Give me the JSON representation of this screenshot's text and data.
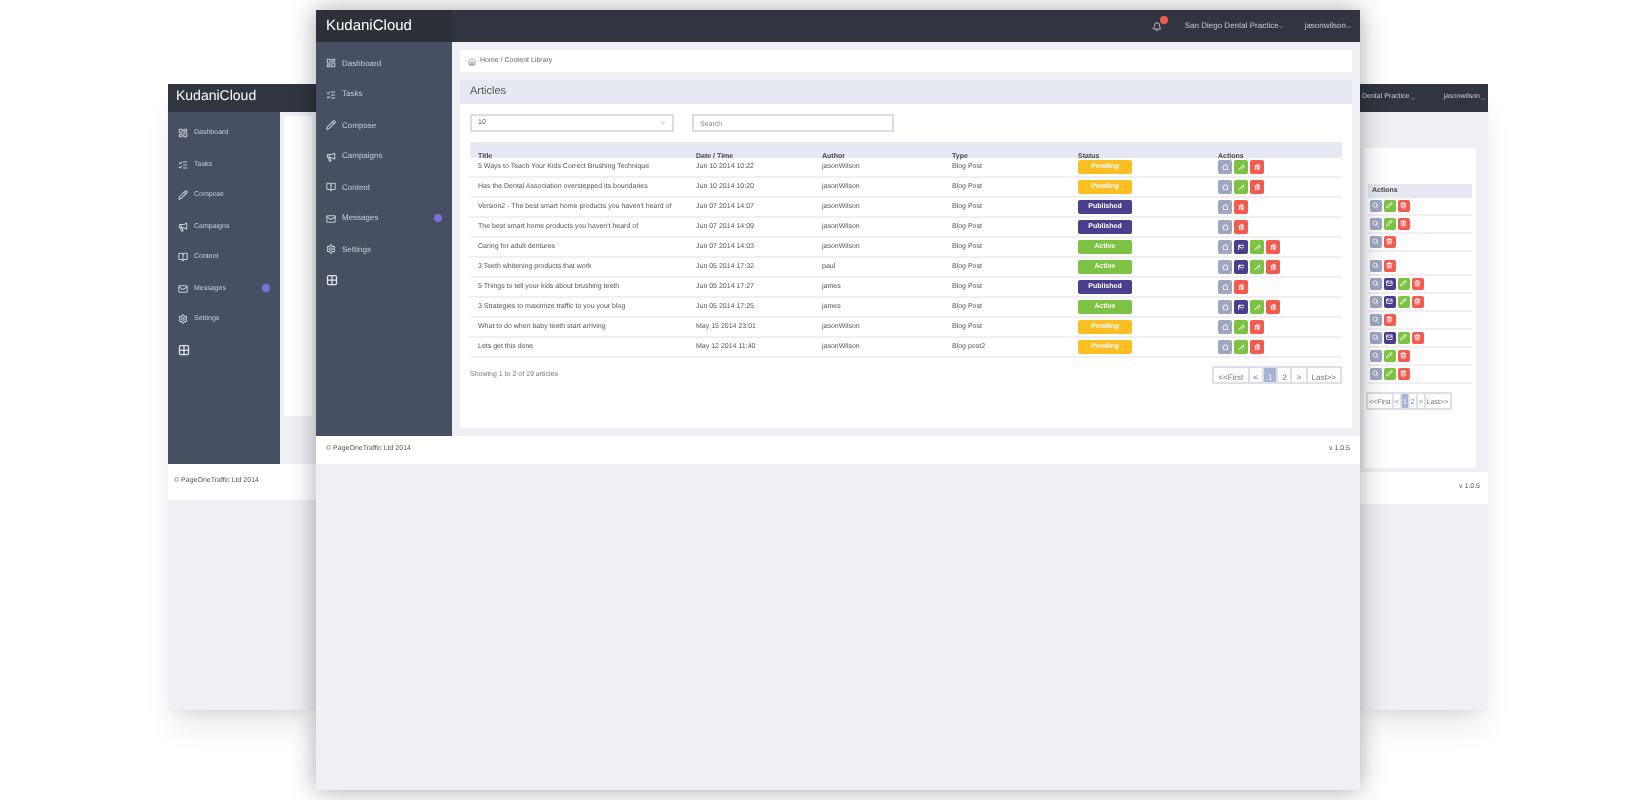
{
  "back_left_window": {
    "logo": "**Kudani**Cloud",
    "sidebar": [
      {
        "label": "Dashboard"
      },
      {
        "label": "Tasks"
      },
      {
        "label": "Compose"
      },
      {
        "label": "Campaigns"
      },
      {
        "label": "Content"
      },
      {
        "label": "Messages",
        "badge": true
      },
      {
        "label": "Settings"
      },
      {
        "kind": "icon_only"
      }
    ],
    "footer": "© PageOneTraffic Ltd 2014"
  },
  "back_right_window": {
    "practice": "Dental Practice",
    "user": "jasonwilson",
    "actions_heading": "Actions",
    "action_rows": [
      [
        {
          "kind": "view"
        },
        {
          "kind": "edit"
        },
        {
          "kind": "delete"
        }
      ],
      [
        {
          "kind": "view"
        },
        {
          "kind": "edit"
        },
        {
          "kind": "delete"
        }
      ],
      [
        {
          "kind": "view"
        },
        {
          "kind": "delete"
        }
      ],
      [
        {
          "kind": "view"
        },
        {
          "kind": "delete"
        }
      ],
      [
        {
          "kind": "view"
        },
        {
          "kind": "message"
        },
        {
          "kind": "edit"
        },
        {
          "kind": "delete"
        }
      ],
      [
        {
          "kind": "view"
        },
        {
          "kind": "message"
        },
        {
          "kind": "edit"
        },
        {
          "kind": "delete"
        }
      ],
      [
        {
          "kind": "view"
        },
        {
          "kind": "delete"
        }
      ],
      [
        {
          "kind": "view"
        },
        {
          "kind": "message"
        },
        {
          "kind": "edit"
        },
        {
          "kind": "delete"
        }
      ],
      [
        {
          "kind": "view"
        },
        {
          "kind": "edit"
        },
        {
          "kind": "delete"
        }
      ],
      [
        {
          "kind": "view"
        },
        {
          "kind": "edit"
        },
        {
          "kind": "delete"
        }
      ]
    ],
    "pagination": [
      {
        "label": "<<First",
        "selected": false
      },
      {
        "label": "<",
        "selected": false
      },
      {
        "label": "1",
        "selected": true
      },
      {
        "label": "2",
        "selected": false
      },
      {
        "label": ">",
        "selected": false
      },
      {
        "label": "Last>>",
        "selected": false
      }
    ],
    "version": "v 1.0.5"
  },
  "window": {
    "logo": "**Kudani**Cloud",
    "notification_badge": true,
    "practice": "San Diego Dental Practice",
    "user": "jasonwilson",
    "sidebar": [
      {
        "label": "Dashboard"
      },
      {
        "label": "Tasks"
      },
      {
        "label": "Compose"
      },
      {
        "label": "Campaigns"
      },
      {
        "label": "Content"
      },
      {
        "label": "Messages",
        "badge": true
      },
      {
        "label": "Settings"
      },
      {
        "kind": "icon_only"
      }
    ],
    "breadcrumb": "Home / Content Library",
    "panel_title": "Articles",
    "page_size": "10",
    "search": {
      "placeholder": "Search"
    },
    "table": {
      "columns": [
        "Title",
        "Date / Time",
        "Author",
        "Type",
        "Status",
        "Actions"
      ],
      "rows": [
        {
          "title": "5 Ways to Teach Your Kids Correct Brushing Technique",
          "date": "Jun 10 2014 10:22",
          "author": "jasonWilson",
          "type": "Blog Post",
          "status": "Pending",
          "color": "#fbbf24",
          "actions": [
            {
              "kind": "view"
            },
            {
              "kind": "edit"
            },
            {
              "kind": "delete"
            }
          ]
        },
        {
          "title": "Has the Dental Association overstepped its boundaries",
          "date": "Jun 10 2014 10:20",
          "author": "jasonWilson",
          "type": "Blog Post",
          "status": "Pending",
          "color": "#fbbf24",
          "actions": [
            {
              "kind": "view"
            },
            {
              "kind": "edit"
            },
            {
              "kind": "delete"
            }
          ]
        },
        {
          "title": "Version2 - The best smart home products you haven't heard of",
          "date": "Jun 07 2014 14:07",
          "author": "jasonWilson",
          "type": "Blog Post",
          "status": "Published",
          "color": "#4a3f8c",
          "actions": [
            {
              "kind": "view"
            },
            {
              "kind": "delete"
            }
          ]
        },
        {
          "title": "The best smart home products you haven't heard of",
          "date": "Jun 07 2014 14:09",
          "author": "jasonWilson",
          "type": "Blog Post",
          "status": "Published",
          "color": "#4a3f8c",
          "actions": [
            {
              "kind": "view"
            },
            {
              "kind": "delete"
            }
          ]
        },
        {
          "title": "Caring for adult dentures",
          "date": "Jun 07 2014 14:03",
          "author": "jasonWilson",
          "type": "Blog Post",
          "status": "Active",
          "color": "#7cc243",
          "actions": [
            {
              "kind": "view"
            },
            {
              "kind": "message"
            },
            {
              "kind": "edit"
            },
            {
              "kind": "delete"
            }
          ]
        },
        {
          "title": "3 Teeth whitening products that work",
          "date": "Jun 05 2014 17:32",
          "author": "paul",
          "type": "Blog Post",
          "status": "Active",
          "color": "#7cc243",
          "actions": [
            {
              "kind": "view"
            },
            {
              "kind": "message"
            },
            {
              "kind": "edit"
            },
            {
              "kind": "delete"
            }
          ]
        },
        {
          "title": "5 Things to tell your kids about brushing teeth",
          "date": "Jun 05 2014 17:27",
          "author": "james",
          "type": "Blog Post",
          "status": "Published",
          "color": "#4a3f8c",
          "actions": [
            {
              "kind": "view"
            },
            {
              "kind": "delete"
            }
          ]
        },
        {
          "title": "3 Strategies to maximize traffic to you your blog",
          "date": "Jun 05 2014 17:25",
          "author": "james",
          "type": "Blog Post",
          "status": "Active",
          "color": "#7cc243",
          "actions": [
            {
              "kind": "view"
            },
            {
              "kind": "message"
            },
            {
              "kind": "edit"
            },
            {
              "kind": "delete"
            }
          ]
        },
        {
          "title": "What to do when baby teeth start arriving",
          "date": "May 15 2014 23:01",
          "author": "jasonWilson",
          "type": "Blog Post",
          "status": "Pending",
          "color": "#fbbf24",
          "actions": [
            {
              "kind": "view"
            },
            {
              "kind": "edit"
            },
            {
              "kind": "delete"
            }
          ]
        },
        {
          "title": "Lets get this done",
          "date": "May 12 2014 11:40",
          "author": "jasonWilson",
          "type": "Blog post2",
          "status": "Pending",
          "color": "#fbbf24",
          "actions": [
            {
              "kind": "view"
            },
            {
              "kind": "edit"
            },
            {
              "kind": "delete"
            }
          ]
        }
      ]
    },
    "summary": "Showing 1 to 2 of 19 articles",
    "pagination": [
      {
        "label": "<<First",
        "selected": false
      },
      {
        "label": "<",
        "selected": false
      },
      {
        "label": "1",
        "selected": true
      },
      {
        "label": "2",
        "selected": false
      },
      {
        "label": ">",
        "selected": false
      },
      {
        "label": "Last>>",
        "selected": false
      }
    ],
    "footer": "© PageOneTraffic Ltd 2014",
    "version": "v 1.0.5"
  }
}
